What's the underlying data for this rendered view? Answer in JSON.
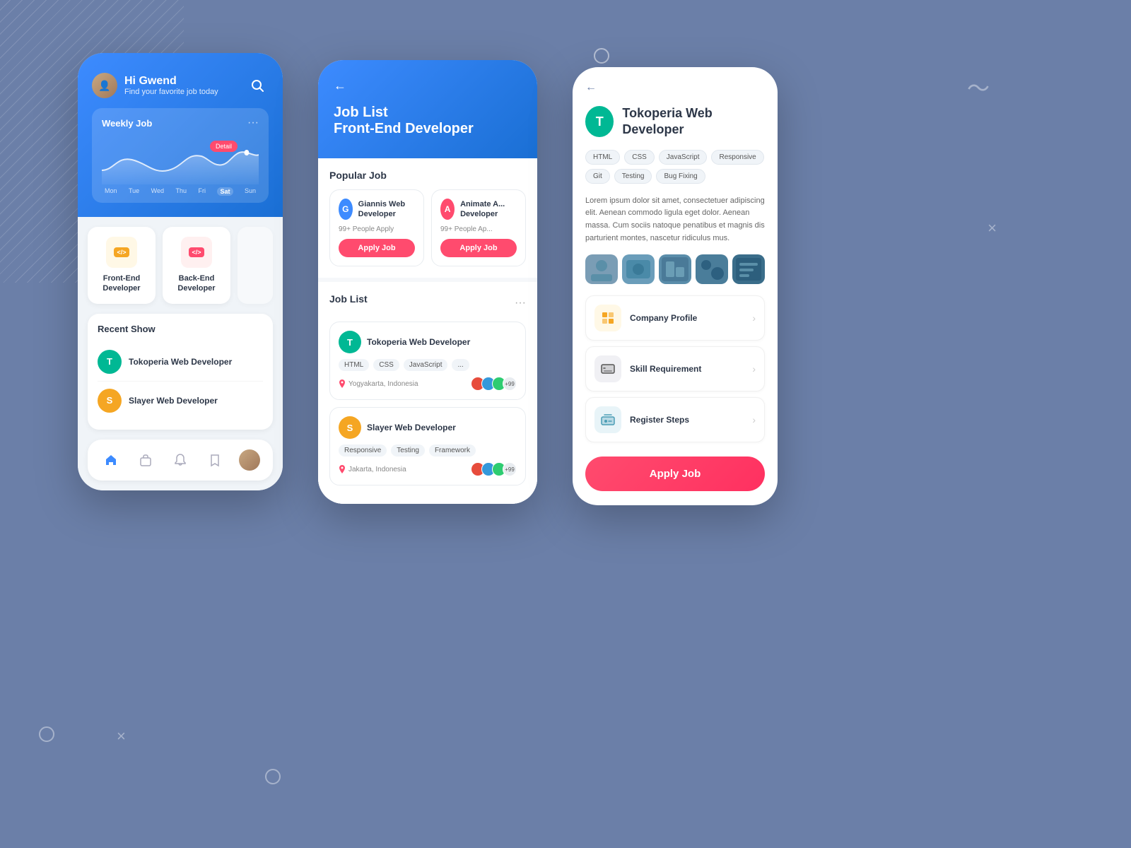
{
  "background": {
    "color": "#6b7fa8"
  },
  "phone1": {
    "greeting": "Hi Gwend",
    "subtitle": "Find your favorite job today",
    "weekly_title": "Weekly Job",
    "days": [
      "Mon",
      "Tue",
      "Wed",
      "Thu",
      "Fri",
      "Sat",
      "Sun"
    ],
    "active_day": "Sat",
    "detail_badge": "Detail",
    "categories": [
      {
        "label": "Front-End\nDeveloper",
        "code": "</>"
      },
      {
        "label": "Back-End\nDeveloper",
        "code": "</>"
      }
    ],
    "recent_title": "Recent Show",
    "recent_items": [
      {
        "initial": "T",
        "color": "#00b894",
        "name": "Tokoperia Web Developer"
      },
      {
        "initial": "S",
        "color": "#f5a623",
        "name": "Slayer Web Developer"
      }
    ],
    "nav_items": [
      "home",
      "bag",
      "bell",
      "bookmark",
      "avatar"
    ]
  },
  "phone2": {
    "back": "←",
    "title": "Job List",
    "subtitle": "Front-End Developer",
    "popular_title": "Popular Job",
    "popular_jobs": [
      {
        "initial": "G",
        "color": "#3d8bff",
        "name": "Giannis Web Developer",
        "count": "99+ People Apply"
      },
      {
        "initial": "A",
        "color": "#ff4b6e",
        "name": "Animate A... Developer",
        "count": "99+ People Ap..."
      }
    ],
    "apply_label": "Apply Job",
    "job_list_title": "Job List",
    "jobs": [
      {
        "initial": "T",
        "color": "#00b894",
        "name": "Tokoperia Web Developer",
        "tags": [
          "HTML",
          "CSS",
          "JavaScript",
          "..."
        ],
        "location": "Yogyakarta, Indonesia",
        "avatars": [
          "#e74c3c",
          "#3498db",
          "#2ecc71"
        ],
        "extra": "+99"
      },
      {
        "initial": "S",
        "color": "#f5a623",
        "name": "Slayer Web Developer",
        "tags": [
          "Responsive",
          "Testing",
          "Framework"
        ],
        "location": "Jakarta, Indonesia",
        "avatars": [
          "#e74c3c",
          "#3498db",
          "#2ecc71"
        ],
        "extra": "+99"
      }
    ]
  },
  "phone3": {
    "back": "←",
    "company_initial": "T",
    "company_color": "#00b894",
    "company_name": "Tokoperia Web Developer",
    "skills": [
      "HTML",
      "CSS",
      "JavaScript",
      "Responsive",
      "Git",
      "Testing",
      "Bug Fixing"
    ],
    "description": "Lorem ipsum dolor sit amet, consectetuer adipiscing elit. Aenean commodo ligula eget dolor. Aenean massa. Cum sociis natoque penatibus et magnis dis parturient montes, nascetur ridiculus mus.",
    "photos": [
      "#8eafc0",
      "#5a8fa8",
      "#4a7d9a",
      "#3d6e8c",
      "#2d5f7d"
    ],
    "sections": [
      {
        "icon": "📋",
        "bg": "#fff8e6",
        "label": "Company Profile"
      },
      {
        "icon": "🏠",
        "bg": "#f0f0f0",
        "label": "Skill Requirement"
      },
      {
        "icon": "💬",
        "bg": "#e8f4f8",
        "label": "Register Steps"
      }
    ],
    "apply_label": "Apply Job"
  }
}
